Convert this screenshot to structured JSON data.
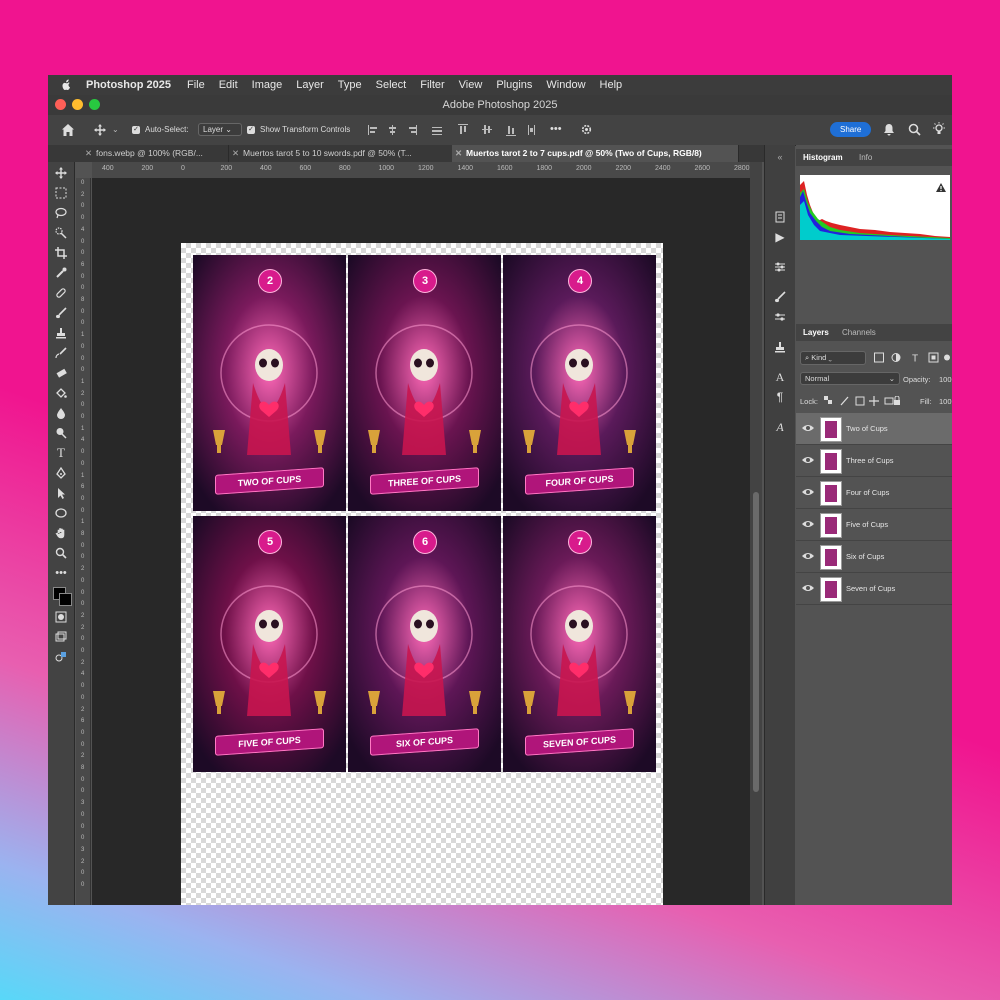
{
  "menubar": {
    "app_name": "Photoshop 2025",
    "items": [
      "File",
      "Edit",
      "Image",
      "Layer",
      "Type",
      "Select",
      "Filter",
      "View",
      "Plugins",
      "Window",
      "Help"
    ]
  },
  "window_title": "Adobe Photoshop 2025",
  "options_bar": {
    "auto_select_label": "Auto-Select:",
    "auto_select_value": "Layer",
    "transform_label": "Show Transform Controls",
    "more": "•••",
    "share_label": "Share"
  },
  "document_tabs": [
    {
      "label": "fons.webp @ 100% (RGB/..."
    },
    {
      "label": "Muertos tarot 5 to 10 swords.pdf @ 50% (T..."
    },
    {
      "label": "Muertos tarot 2 to 7 cups.pdf @ 50% (Two of Cups, RGB/8)"
    }
  ],
  "ruler_top": [
    "400",
    "200",
    "0",
    "200",
    "400",
    "600",
    "800",
    "1000",
    "1200",
    "1400",
    "1600",
    "1800",
    "2000",
    "2200",
    "2400",
    "2600",
    "2800"
  ],
  "ruler_left": [
    "0",
    "2",
    "0",
    "0",
    "4",
    "0",
    "0",
    "6",
    "0",
    "0",
    "8",
    "0",
    "0",
    "1",
    "0",
    "0",
    "0",
    "1",
    "2",
    "0",
    "0",
    "1",
    "4",
    "0",
    "0",
    "1",
    "6",
    "0",
    "0",
    "1",
    "8",
    "0",
    "0",
    "2",
    "0",
    "0",
    "0",
    "2",
    "2",
    "0",
    "0",
    "2",
    "4",
    "0",
    "0",
    "2",
    "6",
    "0",
    "0",
    "2",
    "8",
    "0",
    "0",
    "3",
    "0",
    "0",
    "0",
    "3",
    "2",
    "0",
    "0"
  ],
  "cards": [
    {
      "number": "2",
      "title": "TWO OF CUPS",
      "bg": "#7a1a5c"
    },
    {
      "number": "3",
      "title": "THREE OF CUPS",
      "bg": "#6a1450"
    },
    {
      "number": "4",
      "title": "FOUR OF CUPS",
      "bg": "#5a1a5a"
    },
    {
      "number": "5",
      "title": "FIVE OF CUPS",
      "bg": "#6e1048"
    },
    {
      "number": "6",
      "title": "SIX OF CUPS",
      "bg": "#5e1656"
    },
    {
      "number": "7",
      "title": "SEVEN OF CUPS",
      "bg": "#6a1a58"
    }
  ],
  "panels": {
    "histogram_tab": "Histogram",
    "info_tab": "Info",
    "layers_tab": "Layers",
    "channels_tab": "Channels",
    "kind_label": "Kind",
    "blend_mode": "Normal",
    "opacity_label": "Opacity:",
    "opacity_value": "100",
    "lock_label": "Lock:",
    "fill_label": "Fill:",
    "fill_value": "100"
  },
  "layers": [
    {
      "name": "Two of Cups",
      "selected": true
    },
    {
      "name": "Three of Cups",
      "selected": false
    },
    {
      "name": "Four of Cups",
      "selected": false
    },
    {
      "name": "Five of Cups",
      "selected": false
    },
    {
      "name": "Six of Cups",
      "selected": false
    },
    {
      "name": "Seven of Cups",
      "selected": false
    }
  ],
  "colors": {
    "background_pink": "#f0148f",
    "background_cyan": "#58d8f8",
    "card_magenta": "#d81b8c",
    "banner": "#b0157a",
    "share_blue": "#1f6fd6"
  }
}
